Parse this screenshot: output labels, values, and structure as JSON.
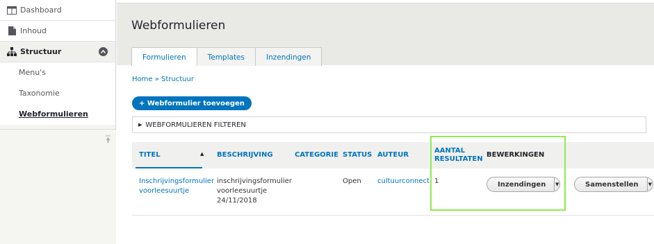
{
  "sidebar": {
    "items": [
      {
        "label": "Dashboard",
        "icon": "dashboard-icon"
      },
      {
        "label": "Inhoud",
        "icon": "document-icon"
      },
      {
        "label": "Structuur",
        "icon": "sitemap-icon"
      }
    ],
    "sub_items": [
      {
        "label": "Menu's"
      },
      {
        "label": "Taxonomie"
      },
      {
        "label": "Webformulieren"
      }
    ]
  },
  "header": {
    "title": "Webformulieren",
    "tabs": [
      {
        "label": "Formulieren"
      },
      {
        "label": "Templates"
      },
      {
        "label": "Inzendingen"
      }
    ]
  },
  "main": {
    "breadcrumb": "Home » Structuur",
    "add_button": "+ Webformulier toevoegen",
    "filter_label": "WEBFORMULIEREN FILTEREN",
    "table": {
      "headers": {
        "titel": "TITEL",
        "beschrijving": "BESCHRIJVING",
        "categorie": "CATEGORIE",
        "status": "STATUS",
        "auteur": "AUTEUR",
        "aantal_1": "AANTAL",
        "aantal_2": "RESULTATEN",
        "bewerkingen": "BEWERKINGEN"
      },
      "rows": [
        {
          "titel_1": "Inschrijvingsformulier",
          "titel_2": "voorleesuurtje",
          "beschrijving_1": "inschrijvingsformulier",
          "beschrijving_2": "voorleesuurtje",
          "beschrijving_3": "24/11/2018",
          "categorie": "",
          "status": "Open",
          "auteur": "cultuurconnect",
          "aantal": "1",
          "op1": "Inzendingen",
          "op2": "Samenstellen"
        }
      ]
    }
  },
  "colors": {
    "accent": "#0074bd",
    "highlight": "#8cec50"
  }
}
